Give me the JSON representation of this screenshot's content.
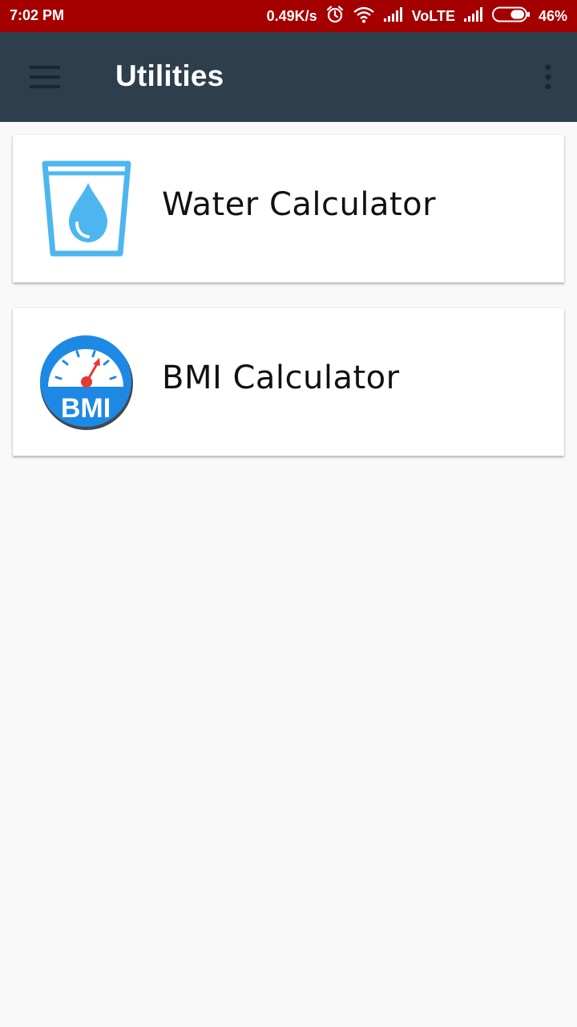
{
  "status_bar": {
    "time": "7:02 PM",
    "net_speed": "0.49K/s",
    "network_label": "VoLTE",
    "battery_percent": "46%",
    "battery_level": 0.46,
    "icons": [
      "alarm-icon",
      "wifi-icon",
      "signal-icon",
      "volte-label",
      "signal-icon",
      "battery-icon"
    ]
  },
  "app_bar": {
    "title": "Utilities",
    "menu_icon": "hamburger-menu-icon",
    "overflow_icon": "more-vert-icon"
  },
  "items": [
    {
      "label": "Water Calculator",
      "icon": "water-glass-icon",
      "accent": "#4db6f0"
    },
    {
      "label": "BMI Calculator",
      "icon": "bmi-gauge-icon",
      "accent": "#1e88e5",
      "icon_text": "BMI"
    }
  ],
  "colors": {
    "status_bar": "#a40000",
    "app_bar": "#2d3f4d",
    "background": "#f9f9f9",
    "card": "#ffffff",
    "gauge_needle": "#e53935"
  }
}
